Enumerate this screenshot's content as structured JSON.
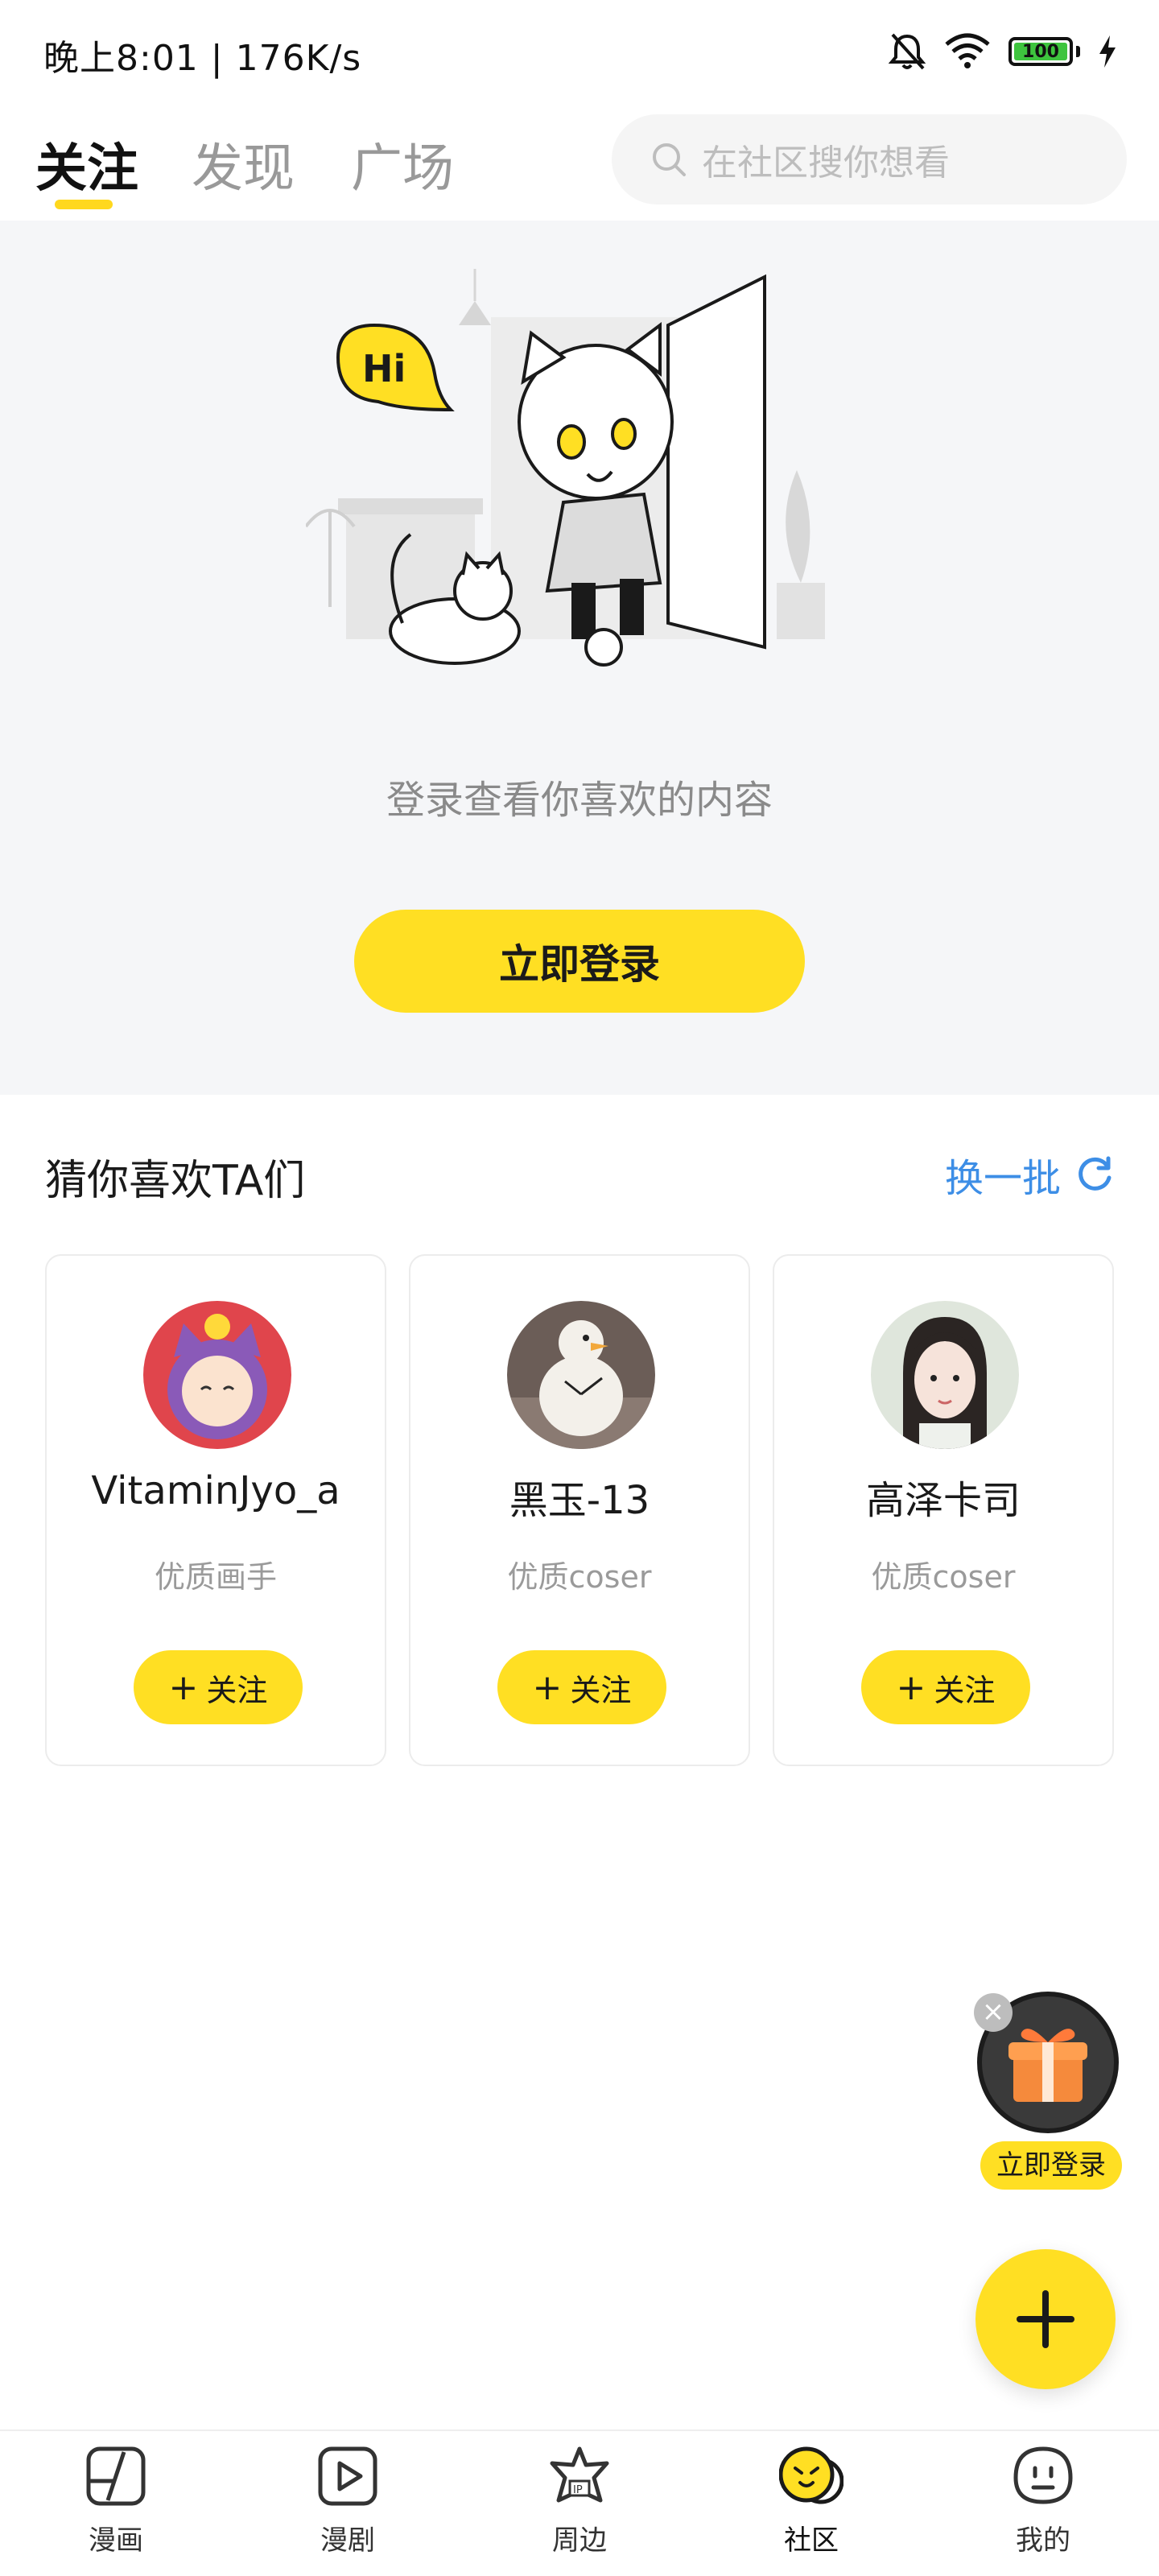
{
  "status_bar": {
    "time_speed": "晚上8:01 | 176K/s",
    "battery": "100"
  },
  "header": {
    "tabs": [
      {
        "label": "关注"
      },
      {
        "label": "发现"
      },
      {
        "label": "广场"
      }
    ],
    "search_placeholder": "在社区搜你想看"
  },
  "login": {
    "illustration_text": "Hi",
    "hint": "登录查看你喜欢的内容",
    "button": "立即登录"
  },
  "recommend": {
    "title": "猜你喜欢TA们",
    "refresh": "换一批",
    "cards": [
      {
        "name": "VitaminJyo_a",
        "tag": "优质画手",
        "follow": "关注"
      },
      {
        "name": "黑玉-13",
        "tag": "优质coser",
        "follow": "关注"
      },
      {
        "name": "高泽卡司",
        "tag": "优质coser",
        "follow": "关注"
      }
    ]
  },
  "gift_float": {
    "label": "立即登录"
  },
  "bottom_nav": [
    {
      "label": "漫画",
      "icon": "manga-icon"
    },
    {
      "label": "漫剧",
      "icon": "video-icon"
    },
    {
      "label": "周边",
      "icon": "merch-icon"
    },
    {
      "label": "社区",
      "icon": "community-icon"
    },
    {
      "label": "我的",
      "icon": "profile-icon"
    }
  ],
  "colors": {
    "accent": "#ffdf23",
    "link": "#3d8ee6",
    "section_bg": "#f5f6f8"
  }
}
